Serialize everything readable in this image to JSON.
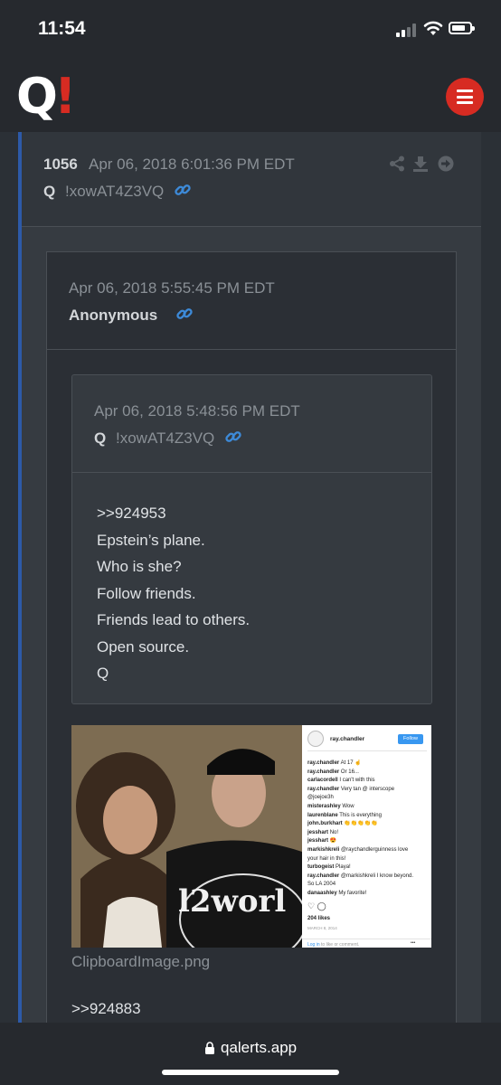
{
  "status_bar": {
    "time": "11:54"
  },
  "brand": {
    "logo_letter": "Q",
    "logo_mark": "!",
    "accent_color": "#d72b22",
    "link_color": "#3d8ad8"
  },
  "post": {
    "number": "1056",
    "date": "Apr 06, 2018 6:01:36 PM EDT",
    "author": "Q",
    "tripcode": "!xowAT4Z3VQ",
    "actions": [
      "share-icon",
      "download-icon",
      "forward-icon"
    ],
    "quoted": {
      "date": "Apr 06, 2018 5:55:45 PM EDT",
      "author": "Anonymous",
      "quoted": {
        "date": "Apr 06, 2018 5:48:56 PM EDT",
        "author": "Q",
        "tripcode": "!xowAT4Z3VQ",
        "lines": [
          ">>924953",
          "Epstein’s plane.",
          "Who is she?",
          "Follow friends.",
          "Friends lead to others.",
          "Open source.",
          "Q"
        ]
      },
      "attachment": {
        "filename": "ClipboardImage.png",
        "caption_overlay": "l2worl",
        "instagram": {
          "username": "ray.chandler",
          "follow_label": "Follow",
          "comments": [
            {
              "user": "ray.chandler",
              "text": "At 17 ☝"
            },
            {
              "user": "ray.chandler",
              "text": "Or 16..."
            },
            {
              "user": "carlacordell",
              "text": "I can't with this"
            },
            {
              "user": "ray.chandler",
              "text": "Very tan @ interscope"
            },
            {
              "user": "",
              "text": "@joejoe3h"
            },
            {
              "user": "misterashley",
              "text": "Wow"
            },
            {
              "user": "laurenblane",
              "text": "This is everything"
            },
            {
              "user": "john.burkhart",
              "text": "👏👏👏👏👏"
            },
            {
              "user": "jesshart",
              "text": "No!"
            },
            {
              "user": "jesshart",
              "text": "😍"
            },
            {
              "user": "markishkreli",
              "text": "@raychandlerguinness love"
            },
            {
              "user": "",
              "text": "your hair in this!"
            },
            {
              "user": "turbogeist",
              "text": "Playa!"
            },
            {
              "user": "ray.chandler",
              "text": "@markishkreli I know beyond."
            },
            {
              "user": "",
              "text": "So LA 2004"
            },
            {
              "user": "danaashley",
              "text": "My favorite!"
            }
          ],
          "likes": "204 likes",
          "date": "MARCH 8, 2014",
          "footer_link": "Log in",
          "footer_text": "to like or comment."
        }
      },
      "reply_text": ">>924883"
    }
  },
  "browser": {
    "url": "qalerts.app"
  }
}
